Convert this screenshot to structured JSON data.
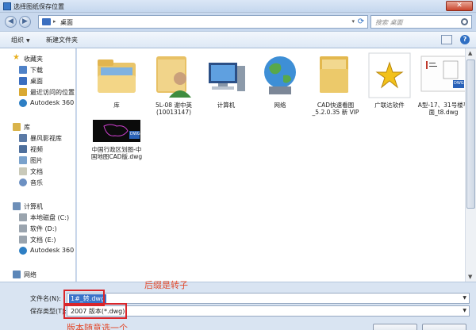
{
  "window": {
    "title": "选择图纸保存位置",
    "close_label": "✕"
  },
  "address": {
    "crumb": "桌面",
    "separator": "▸"
  },
  "search": {
    "placeholder": "搜索 桌面"
  },
  "toolbar": {
    "organize": "组织",
    "new_folder": "新建文件夹",
    "help": "?"
  },
  "nav": {
    "favorites": {
      "header": "收藏夹",
      "items": [
        "下载",
        "桌面",
        "最近访问的位置",
        "Autodesk 360"
      ]
    },
    "libraries": {
      "header": "库",
      "items": [
        "暴风影视库",
        "视频",
        "图片",
        "文档",
        "音乐"
      ]
    },
    "computer": {
      "header": "计算机",
      "items": [
        "本地磁盘 (C:)",
        "软件 (D:)",
        "文档 (E:)",
        "Autodesk 360"
      ]
    },
    "network": {
      "header": "网络"
    }
  },
  "files": [
    {
      "name": "库",
      "icon": "library-folder-icon"
    },
    {
      "name": "5L-08 谢中英 (10013147)",
      "icon": "user-icon"
    },
    {
      "name": "计算机",
      "icon": "computer-icon"
    },
    {
      "name": "网络",
      "icon": "network-globe-icon"
    },
    {
      "name": "CAD快速看图_5.2.0.35 新 VIP",
      "icon": "folder-icon"
    },
    {
      "name": "广联达软件",
      "icon": "star-shortcut-icon"
    },
    {
      "name": "A型-17、31号楼平面_t8.dwg",
      "icon": "dwg-thumbnail-icon"
    },
    {
      "name": "中国行政区划图-中国地图CAD版.dwg",
      "icon": "dwg-thumbnail-icon"
    }
  ],
  "thumb_badge": "DWG",
  "form": {
    "filename_label": "文件名(N):",
    "filename_value": "1#_转.dwg",
    "filetype_label": "保存类型(T):",
    "filetype_value": "2007 版本(*.dwg)",
    "hide_folders": "隐藏文件夹"
  },
  "annotations": {
    "suffix_note": "后缀是转子",
    "version_note": "版本随意选一个"
  },
  "colors": {
    "annotation_red": "#d9252a",
    "selection_blue": "#3a73c9"
  }
}
